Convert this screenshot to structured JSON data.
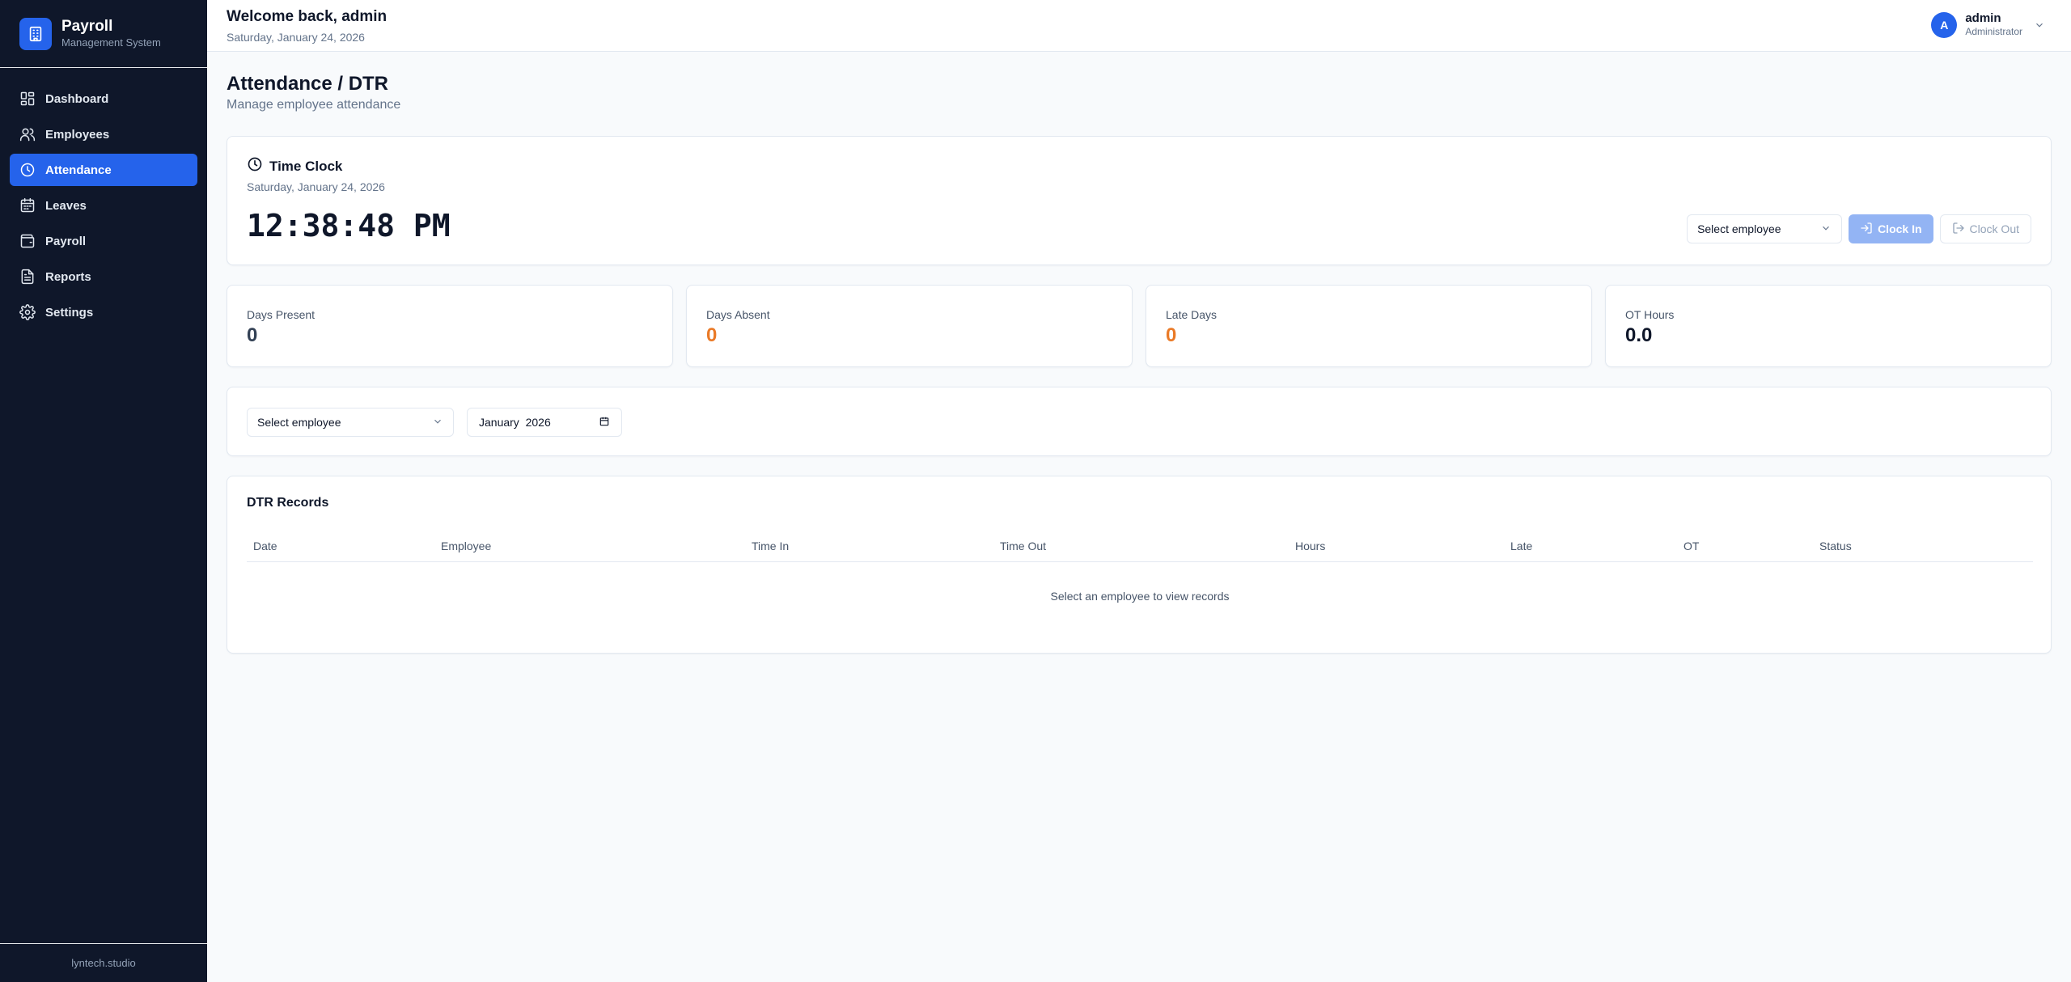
{
  "brand": {
    "title": "Payroll",
    "subtitle": "Management System"
  },
  "sidebar": {
    "items": [
      {
        "label": "Dashboard",
        "icon": "dashboard-icon"
      },
      {
        "label": "Employees",
        "icon": "users-icon"
      },
      {
        "label": "Attendance",
        "icon": "clock-icon",
        "active": true
      },
      {
        "label": "Leaves",
        "icon": "calendar-icon"
      },
      {
        "label": "Payroll",
        "icon": "wallet-icon"
      },
      {
        "label": "Reports",
        "icon": "file-text-icon"
      },
      {
        "label": "Settings",
        "icon": "gear-icon"
      }
    ],
    "footer": "lyntech.studio"
  },
  "header": {
    "welcome": "Welcome back, admin",
    "date": "Saturday, January 24, 2026",
    "user": {
      "initial": "A",
      "name": "admin",
      "role": "Administrator"
    }
  },
  "page": {
    "title": "Attendance / DTR",
    "subtitle": "Manage employee attendance"
  },
  "timeclock": {
    "title": "Time Clock",
    "date": "Saturday, January 24, 2026",
    "time": "12:38:48 PM",
    "employee_select": "Select employee",
    "clock_in": "Clock In",
    "clock_out": "Clock Out"
  },
  "stats": [
    {
      "label": "Days Present",
      "value": "0",
      "color": "#334155"
    },
    {
      "label": "Days Absent",
      "value": "0",
      "color": "#ea7a27"
    },
    {
      "label": "Late Days",
      "value": "0",
      "color": "#ea7a27"
    },
    {
      "label": "OT Hours",
      "value": "0.0",
      "color": "#0f172a"
    }
  ],
  "filters": {
    "employee_select": "Select employee",
    "month": "January  2026"
  },
  "records": {
    "title": "DTR Records",
    "columns": [
      "Date",
      "Employee",
      "Time In",
      "Time Out",
      "Hours",
      "Late",
      "OT",
      "Status"
    ],
    "empty": "Select an employee to view records"
  },
  "colors": {
    "sidebar_bg": "#0f172a",
    "accent": "#2563eb",
    "warning": "#ea7a27"
  }
}
